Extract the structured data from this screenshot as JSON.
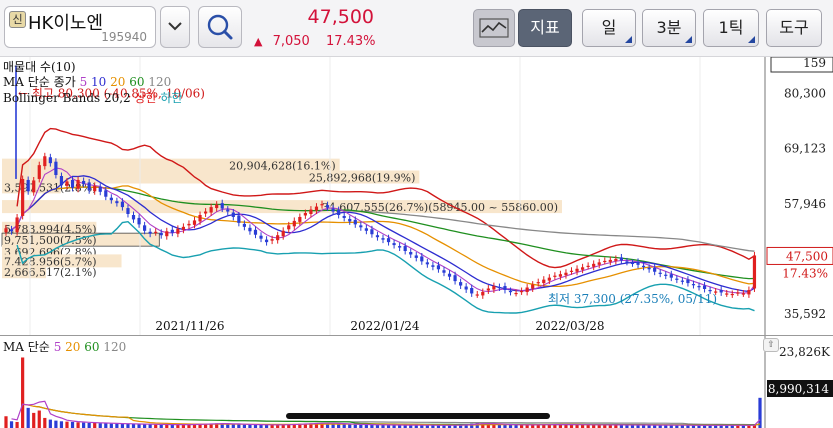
{
  "header": {
    "credit_badge": "신",
    "stock_name": "HK이노엔",
    "stock_code": "195940",
    "price": "47,500",
    "change_arrow": "▲",
    "change_amount": "7,050",
    "change_rate": "17.43%",
    "buttons": {
      "indicator": "지표",
      "period": "일",
      "minute": "3분",
      "tick": "1틱",
      "tools": "도구"
    }
  },
  "legend": {
    "volume_ma": "매물대 수(10)",
    "ma_label": "MA 단순 종가",
    "ma_periods": [
      "5",
      "10",
      "20",
      "60",
      "120"
    ],
    "bollinger": "Bollinger Bands 20,2",
    "bb_upper": "상한",
    "bb_lower": "하한"
  },
  "volume_legend": {
    "label": "MA 단순",
    "periods": [
      "5",
      "20",
      "60",
      "120"
    ]
  },
  "colors": {
    "up": "#e02020",
    "down": "#2a3dd6",
    "ma5": "#b040c8",
    "ma10": "#2d2dd0",
    "ma20": "#e69000",
    "ma60": "#1f8f1f",
    "ma120": "#888888",
    "bb_upper": "#d01818",
    "bb_lower": "#18a0b0",
    "volume_profile": "#f8e6cc"
  },
  "chart_data": {
    "type": "candlestick",
    "price_axis": {
      "range": [
        33000,
        86500
      ],
      "labels": [
        {
          "text": "159",
          "value": 86500,
          "boxed": true
        },
        {
          "text": "80,300",
          "value": 80300
        },
        {
          "text": "69,123",
          "value": 69123
        },
        {
          "text": "57,946",
          "value": 57946
        },
        {
          "text": "35,592",
          "value": 35592
        }
      ],
      "current_price_label": {
        "text": "47,500",
        "value": 47500
      },
      "current_rate_label": "17.43%"
    },
    "date_labels": [
      "2021/11/26",
      "2022/01/24",
      "2022/03/28"
    ],
    "annotations": {
      "high": "← 최고 80,300 (-40.85%, 10/06)",
      "low": "최저 37,300 (27.35%, 05/11)"
    },
    "volume_profile_bins": [
      {
        "label": "20,904,628(16.1%)",
        "price": 65800,
        "fraction": 0.161
      },
      {
        "label": "25,892,968(19.9%)",
        "price": 63400,
        "fraction": 0.199
      },
      {
        "label": "3,597,531(2.8%)",
        "price": 61400,
        "fraction": 0.028
      },
      {
        "label": "34,607,555(26.7%)(58945.00 ~ 55860.00)",
        "price": 57400,
        "fraction": 0.267
      },
      {
        "label": "5,783,994(4.5%)",
        "price": 53000,
        "fraction": 0.045
      },
      {
        "label": "9,751,500(7.5%)",
        "price": 50700,
        "fraction": 0.075
      },
      {
        "label": "3,692,696(2.8%)",
        "price": 48300,
        "fraction": 0.028
      },
      {
        "label": "7,428,956(5.7%)",
        "price": 46400,
        "fraction": 0.057
      },
      {
        "label": "2,666,517(2.1%)",
        "price": 44200,
        "fraction": 0.021
      }
    ],
    "closes": [
      53000,
      52400,
      55200,
      63000,
      60500,
      62700,
      65800,
      67600,
      66200,
      63800,
      61800,
      62500,
      61200,
      62800,
      62000,
      60700,
      61600,
      60400,
      59400,
      58700,
      58100,
      57300,
      55900,
      54800,
      53800,
      52500,
      51900,
      52300,
      51600,
      52400,
      52100,
      52900,
      53300,
      53900,
      54600,
      55700,
      56400,
      57300,
      57800,
      57000,
      56400,
      55300,
      54100,
      53300,
      52400,
      51700,
      50900,
      50200,
      50800,
      51600,
      52500,
      53600,
      54500,
      55300,
      56100,
      56800,
      57400,
      57900,
      57200,
      56400,
      55700,
      55100,
      54400,
      53800,
      53200,
      52500,
      51800,
      51200,
      50700,
      50200,
      49600,
      49100,
      48400,
      47700,
      47000,
      46300,
      45700,
      45200,
      44700,
      44000,
      43200,
      42300,
      41400,
      40600,
      39800,
      39600,
      40100,
      40800,
      41300,
      41000,
      40500,
      40100,
      39900,
      40300,
      41000,
      41600,
      42100,
      42600,
      43000,
      43400,
      43700,
      44000,
      44400,
      44800,
      45100,
      45400,
      45800,
      46100,
      46400,
      46600,
      46800,
      46500,
      46200,
      45900,
      45600,
      45200,
      44700,
      44200,
      43800,
      43400,
      43000,
      42600,
      42300,
      41900,
      41500,
      41100,
      40700,
      40400,
      40200,
      40000,
      39800,
      39700,
      40000,
      39800,
      40500,
      47500
    ],
    "volume_profile_scale_note": "",
    "volume_axis": {
      "top_label": "23,826K",
      "current_label": "8,990,314"
    },
    "volumes": [
      3500,
      2000,
      1800,
      21000,
      6000,
      4500,
      5200,
      3000,
      2500,
      2200,
      2000,
      1900,
      1800,
      1700,
      1600,
      1500,
      1500,
      1400,
      1400,
      1300,
      1300,
      1200,
      1200,
      1200,
      1100,
      1100,
      1100,
      1000,
      1000,
      1000,
      1000,
      1000,
      1000,
      1100,
      1100,
      1200,
      1300,
      1300,
      1400,
      1300,
      1200,
      1100,
      1100,
      1000,
      1000,
      950,
      950,
      900,
      900,
      950,
      1000,
      1100,
      1200,
      1300,
      1300,
      1400,
      1500,
      1500,
      1400,
      1300,
      1200,
      1100,
      1100,
      1000,
      1000,
      950,
      950,
      900,
      900,
      900,
      850,
      850,
      850,
      850,
      850,
      800,
      800,
      800,
      800,
      800,
      800,
      900,
      1000,
      1100,
      1300,
      1600,
      1400,
      1200,
      1100,
      1000,
      1000,
      900,
      900,
      900,
      950,
      1000,
      1000,
      1000,
      1000,
      1000,
      1000,
      1000,
      1000,
      950,
      950,
      950,
      950,
      950,
      900,
      900,
      900,
      900,
      900,
      900,
      900,
      850,
      850,
      850,
      850,
      850,
      850,
      800,
      800,
      800,
      800,
      800,
      800,
      800,
      800,
      800,
      800,
      800,
      800,
      800,
      850,
      900,
      8990
    ]
  }
}
